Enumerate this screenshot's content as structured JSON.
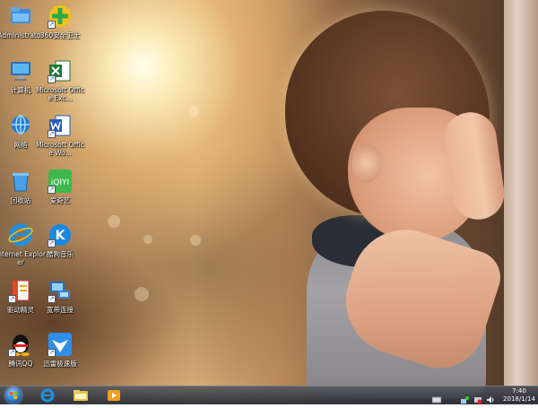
{
  "desktop": {
    "icons": [
      {
        "label": "Administrator",
        "icon": "user-folder-icon"
      },
      {
        "label": "360安全卫士",
        "icon": "360-security-icon"
      },
      {
        "label": "计算机",
        "icon": "computer-icon"
      },
      {
        "label": "Microsoft Office Exc...",
        "icon": "excel-icon"
      },
      {
        "label": "网络",
        "icon": "network-icon"
      },
      {
        "label": "Microsoft Office Wo...",
        "icon": "word-icon"
      },
      {
        "label": "回收站",
        "icon": "recycle-bin-icon"
      },
      {
        "label": "爱奇艺",
        "icon": "iqiyi-icon"
      },
      {
        "label": "Internet Explorer",
        "icon": "internet-explorer-icon"
      },
      {
        "label": "酷狗音乐",
        "icon": "kugou-music-icon"
      },
      {
        "label": "驱动精灵",
        "icon": "driver-genius-icon"
      },
      {
        "label": "宽带连接",
        "icon": "broadband-connection-icon"
      },
      {
        "label": "腾讯QQ",
        "icon": "qq-icon"
      },
      {
        "label": "迅雷极速版",
        "icon": "xunlei-icon"
      }
    ]
  },
  "taskbar": {
    "pinned": [
      {
        "icon": "internet-explorer-icon"
      },
      {
        "icon": "file-explorer-icon"
      },
      {
        "icon": "media-player-icon"
      }
    ],
    "tray": {
      "icons": [
        "keyboard-icon",
        "network-status-icon",
        "action-center-icon",
        "volume-icon"
      ],
      "time": "7:40",
      "date": "2018/1/14"
    }
  },
  "colors": {
    "taskbar": "#2f333b",
    "ie_blue": "#1e8fe0",
    "excel_green": "#1f7a3a",
    "word_blue": "#2a5cb8",
    "iqiyi_green": "#3cb94a",
    "qq_black": "#111111"
  }
}
